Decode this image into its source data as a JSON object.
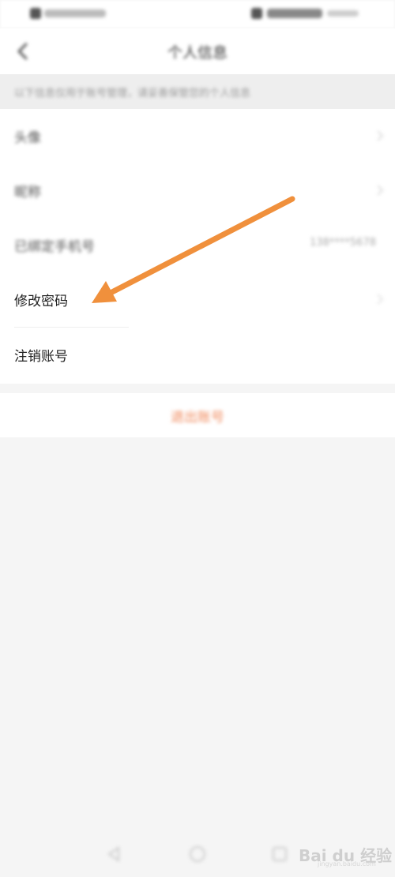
{
  "nav": {
    "title": "个人信息"
  },
  "notice": {
    "text": "以下信息仅用于账号管理，请妥善保管您的个人信息"
  },
  "menu": {
    "items": [
      {
        "label": "头像",
        "value": ""
      },
      {
        "label": "昵称",
        "value": ""
      },
      {
        "label": "已绑定手机号",
        "value": "138****5678"
      },
      {
        "label": "修改密码",
        "value": ""
      },
      {
        "label": "注销账号",
        "value": ""
      }
    ]
  },
  "logout": {
    "label": "退出账号"
  },
  "annotation": {
    "arrow_color": "#f0903c"
  },
  "watermark": {
    "text": "Bai du 经验",
    "sub": "jingyan.baidu.com"
  },
  "icons": [
    "back-icon",
    "chevron-right-icon",
    "nav-back-icon",
    "nav-home-icon",
    "nav-recent-icon"
  ]
}
